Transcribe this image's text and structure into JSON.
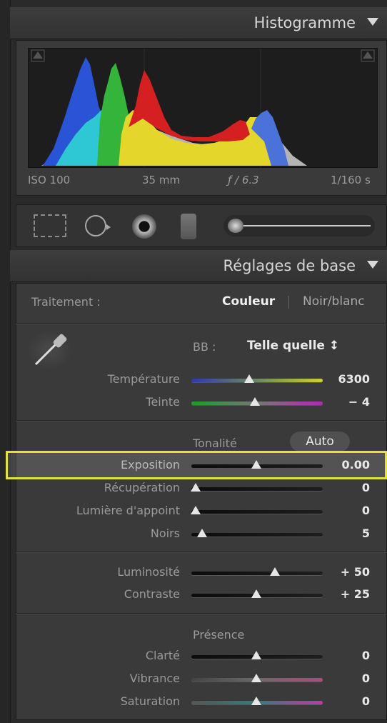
{
  "histogram": {
    "title": "Histogramme",
    "iso": "ISO 100",
    "focal": "35 mm",
    "aperture": "ƒ / 6.3",
    "shutter": "1/160 s"
  },
  "basic": {
    "title": "Réglages de base",
    "treatment_label": "Traitement :",
    "color_option": "Couleur",
    "bw_option": "Noir/blanc",
    "wb_label": "BB :",
    "wb_value": "Telle quelle ↕",
    "tone_title": "Tonalité",
    "auto_button": "Auto",
    "presence_title": "Présence"
  },
  "sliders": [
    {
      "label": "Température",
      "value": "6300",
      "position": 0.44,
      "gradient": "temp"
    },
    {
      "label": "Teinte",
      "value": "− 4",
      "position": 0.49,
      "gradient": "tint"
    },
    {
      "label": "Exposition",
      "value": "0.00",
      "position": 0.5,
      "gradient": "dark"
    },
    {
      "label": "Récupération",
      "value": "0",
      "position": 0.0,
      "gradient": "dark"
    },
    {
      "label": "Lumière d'appoint",
      "value": "0",
      "position": 0.0,
      "gradient": "dark"
    },
    {
      "label": "Noirs",
      "value": "5",
      "position": 0.05,
      "gradient": "dark"
    },
    {
      "label": "Luminosité",
      "value": "+ 50",
      "position": 0.65,
      "gradient": "dark"
    },
    {
      "label": "Contraste",
      "value": "+ 25",
      "position": 0.5,
      "gradient": "dark"
    },
    {
      "label": "Clarté",
      "value": "0",
      "position": 0.5,
      "gradient": "dark"
    },
    {
      "label": "Vibrance",
      "value": "0",
      "position": 0.5,
      "gradient": "vib"
    },
    {
      "label": "Saturation",
      "value": "0",
      "position": 0.5,
      "gradient": "sat"
    }
  ],
  "colors": {
    "highlight_box": "#e3e23a",
    "panel_bg": "#3a3a3a"
  }
}
